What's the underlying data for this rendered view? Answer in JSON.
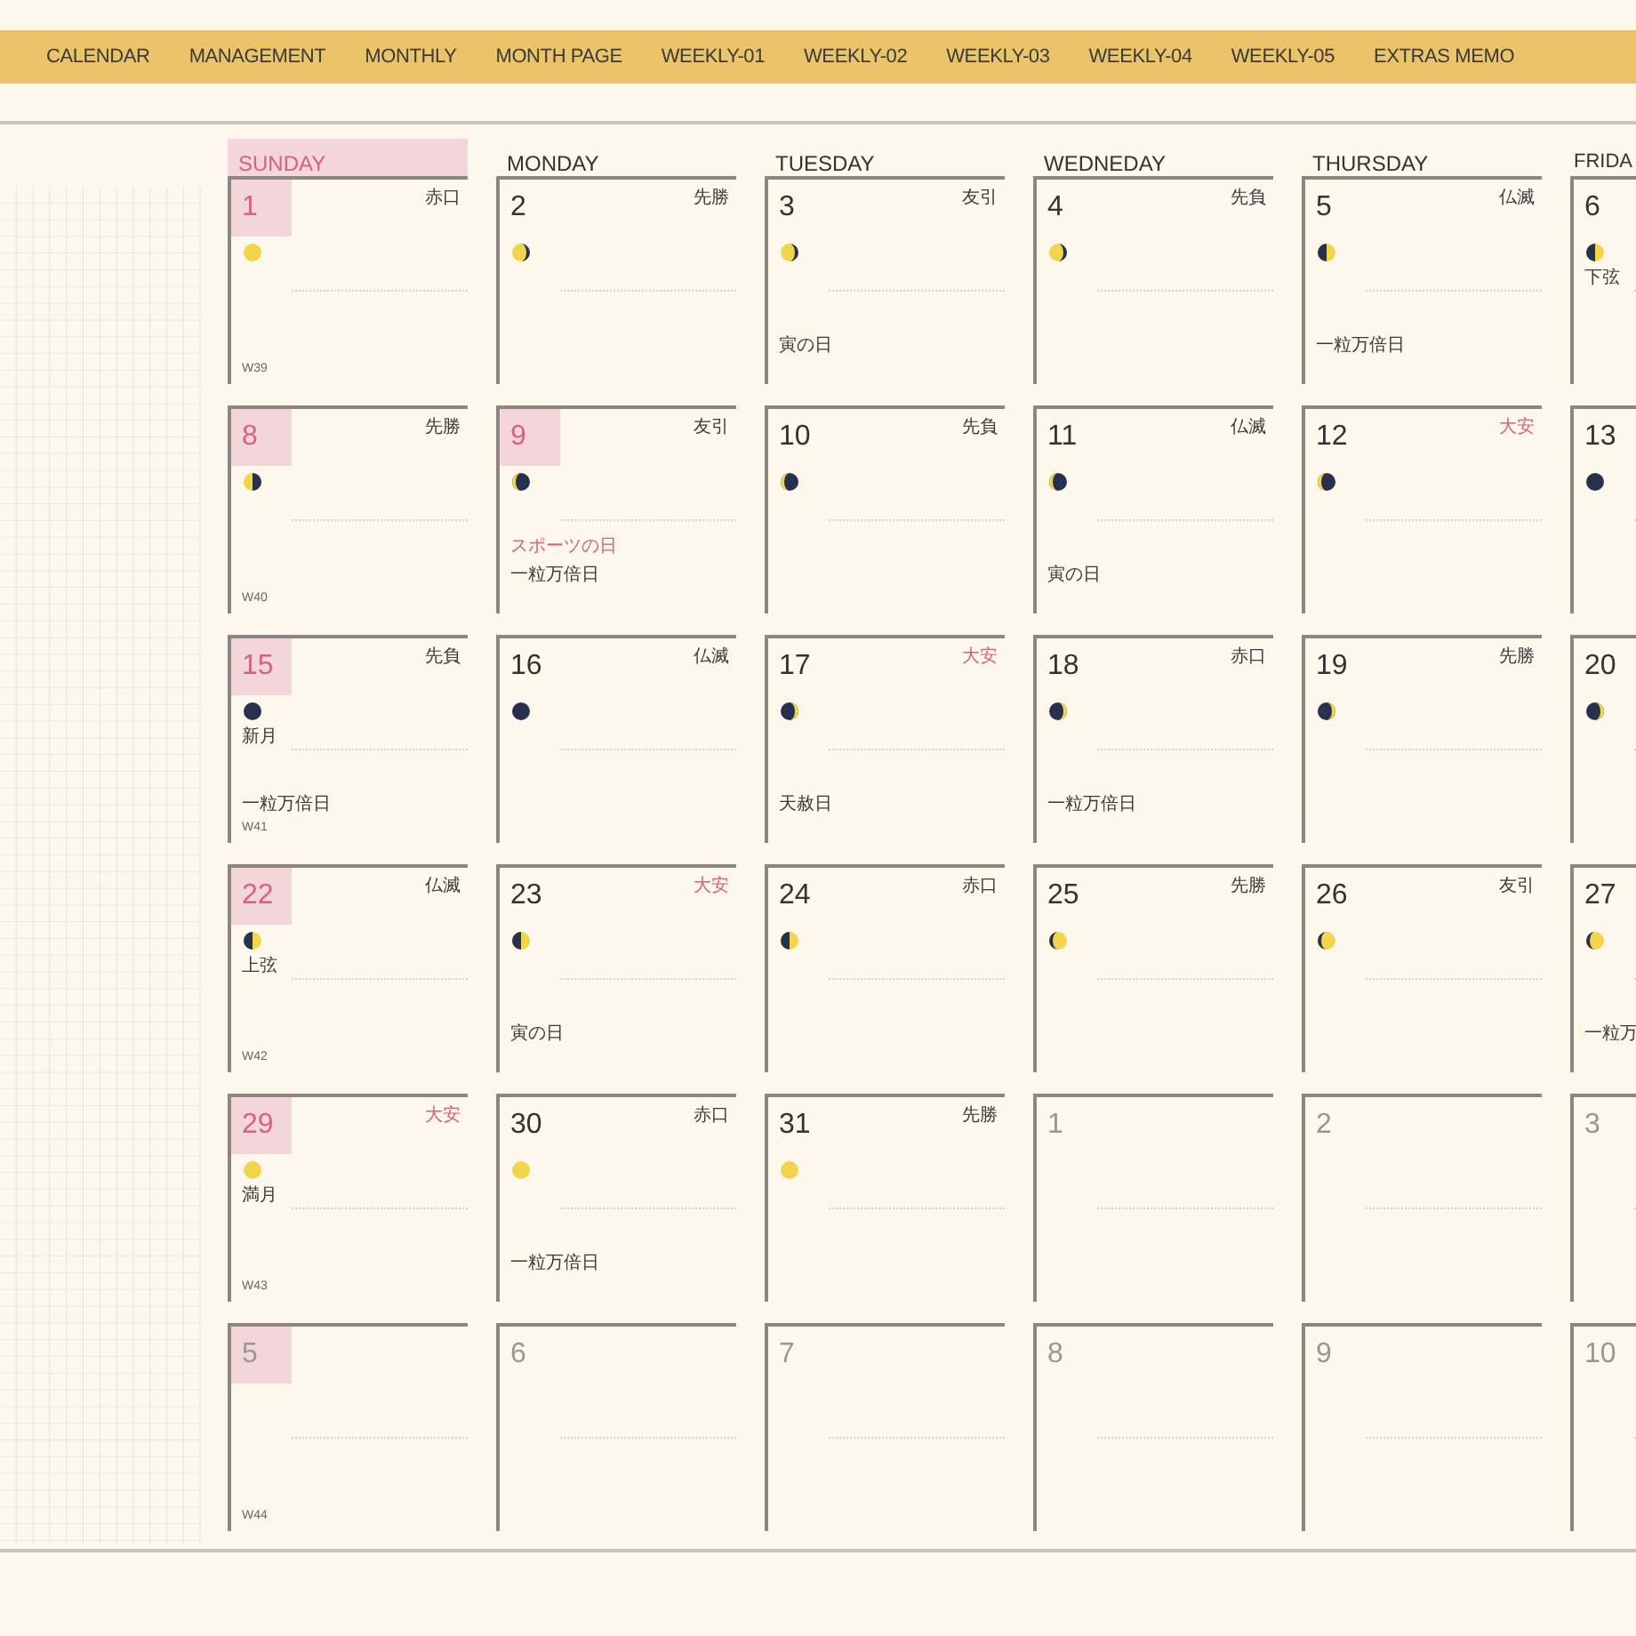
{
  "nav": [
    {
      "label": "CALENDAR"
    },
    {
      "label": "MANAGEMENT"
    },
    {
      "label": "MONTHLY"
    },
    {
      "label": "MONTH PAGE"
    },
    {
      "label": "WEEKLY-01"
    },
    {
      "label": "WEEKLY-02"
    },
    {
      "label": "WEEKLY-03"
    },
    {
      "label": "WEEKLY-04"
    },
    {
      "label": "WEEKLY-05"
    },
    {
      "label": "EXTRAS MEMO"
    }
  ],
  "weekdays": [
    {
      "label": "SUNDAY",
      "highlighted": true
    },
    {
      "label": "MONDAY",
      "highlighted": false
    },
    {
      "label": "TUESDAY",
      "highlighted": false
    },
    {
      "label": "WEDNEDAY",
      "highlighted": false
    },
    {
      "label": "THURSDAY",
      "highlighted": false
    },
    {
      "label": "FRIDA",
      "highlighted": false
    }
  ],
  "weeks": [
    [
      {
        "date": "1",
        "highlighted": true,
        "other_month": false,
        "rokuyo": {
          "text": "赤口",
          "color": "#3a3a3a"
        },
        "moon": {
          "kind": "full"
        },
        "week": "W39"
      },
      {
        "date": "2",
        "highlighted": false,
        "other_month": false,
        "rokuyo": {
          "text": "先勝",
          "color": "#3a3a3a"
        },
        "moon": {
          "kind": "gibbous-dark-right"
        }
      },
      {
        "date": "3",
        "highlighted": false,
        "other_month": false,
        "rokuyo": {
          "text": "友引",
          "color": "#3a3a3a"
        },
        "moon": {
          "kind": "gibbous-dark-right"
        },
        "events": [
          {
            "text": "寅の日",
            "color": "#3a3a3a"
          }
        ]
      },
      {
        "date": "4",
        "highlighted": false,
        "other_month": false,
        "rokuyo": {
          "text": "先負",
          "color": "#3a3a3a"
        },
        "moon": {
          "kind": "gibbous-dark-right"
        }
      },
      {
        "date": "5",
        "highlighted": false,
        "other_month": false,
        "rokuyo": {
          "text": "仏滅",
          "color": "#3a3a3a"
        },
        "moon": {
          "kind": "half-dark-left"
        },
        "events": [
          {
            "text": "一粒万倍日",
            "color": "#3a3a3a"
          }
        ]
      },
      {
        "date": "6",
        "highlighted": false,
        "other_month": false,
        "moon": {
          "kind": "half-dark-left"
        },
        "moon_label": "下弦"
      }
    ],
    [
      {
        "date": "8",
        "highlighted": true,
        "other_month": false,
        "rokuyo": {
          "text": "先勝",
          "color": "#3a3a3a"
        },
        "moon": {
          "kind": "half-dark-right"
        },
        "week": "W40"
      },
      {
        "date": "9",
        "highlighted": true,
        "other_month": false,
        "rokuyo": {
          "text": "友引",
          "color": "#3a3a3a"
        },
        "moon": {
          "kind": "crescent-lit-left"
        },
        "events": [
          {
            "text": "スポーツの日",
            "color": "#d9607f"
          },
          {
            "text": "一粒万倍日",
            "color": "#3a3a3a"
          }
        ]
      },
      {
        "date": "10",
        "highlighted": false,
        "other_month": false,
        "rokuyo": {
          "text": "先負",
          "color": "#3a3a3a"
        },
        "moon": {
          "kind": "crescent-lit-left"
        }
      },
      {
        "date": "11",
        "highlighted": false,
        "other_month": false,
        "rokuyo": {
          "text": "仏滅",
          "color": "#3a3a3a"
        },
        "moon": {
          "kind": "crescent-lit-left"
        },
        "events": [
          {
            "text": "寅の日",
            "color": "#3a3a3a"
          }
        ]
      },
      {
        "date": "12",
        "highlighted": false,
        "other_month": false,
        "rokuyo": {
          "text": "大安",
          "color": "#d9607f"
        },
        "moon": {
          "kind": "crescent-lit-left"
        }
      },
      {
        "date": "13",
        "highlighted": false,
        "other_month": false,
        "moon": {
          "kind": "new"
        }
      }
    ],
    [
      {
        "date": "15",
        "highlighted": true,
        "other_month": false,
        "rokuyo": {
          "text": "先負",
          "color": "#3a3a3a"
        },
        "moon": {
          "kind": "new"
        },
        "moon_label": "新月",
        "events": [
          {
            "text": "一粒万倍日",
            "color": "#3a3a3a"
          }
        ],
        "week": "W41"
      },
      {
        "date": "16",
        "highlighted": false,
        "other_month": false,
        "rokuyo": {
          "text": "仏滅",
          "color": "#3a3a3a"
        },
        "moon": {
          "kind": "new"
        }
      },
      {
        "date": "17",
        "highlighted": false,
        "other_month": false,
        "rokuyo": {
          "text": "大安",
          "color": "#d9607f"
        },
        "moon": {
          "kind": "crescent-lit-right"
        },
        "events": [
          {
            "text": "天赦日",
            "color": "#3a3a3a"
          }
        ]
      },
      {
        "date": "18",
        "highlighted": false,
        "other_month": false,
        "rokuyo": {
          "text": "赤口",
          "color": "#3a3a3a"
        },
        "moon": {
          "kind": "crescent-lit-right"
        },
        "events": [
          {
            "text": "一粒万倍日",
            "color": "#3a3a3a"
          }
        ]
      },
      {
        "date": "19",
        "highlighted": false,
        "other_month": false,
        "rokuyo": {
          "text": "先勝",
          "color": "#3a3a3a"
        },
        "moon": {
          "kind": "crescent-lit-right"
        }
      },
      {
        "date": "20",
        "highlighted": false,
        "other_month": false,
        "moon": {
          "kind": "crescent-lit-right"
        }
      }
    ],
    [
      {
        "date": "22",
        "highlighted": true,
        "other_month": false,
        "rokuyo": {
          "text": "仏滅",
          "color": "#3a3a3a"
        },
        "moon": {
          "kind": "half-dark-left"
        },
        "moon_label": "上弦",
        "week": "W42"
      },
      {
        "date": "23",
        "highlighted": false,
        "other_month": false,
        "rokuyo": {
          "text": "大安",
          "color": "#d9607f"
        },
        "moon": {
          "kind": "half-dark-left"
        },
        "events": [
          {
            "text": "寅の日",
            "color": "#3a3a3a"
          }
        ]
      },
      {
        "date": "24",
        "highlighted": false,
        "other_month": false,
        "rokuyo": {
          "text": "赤口",
          "color": "#3a3a3a"
        },
        "moon": {
          "kind": "half-dark-left"
        }
      },
      {
        "date": "25",
        "highlighted": false,
        "other_month": false,
        "rokuyo": {
          "text": "先勝",
          "color": "#3a3a3a"
        },
        "moon": {
          "kind": "gibbous-dark-left"
        }
      },
      {
        "date": "26",
        "highlighted": false,
        "other_month": false,
        "rokuyo": {
          "text": "友引",
          "color": "#3a3a3a"
        },
        "moon": {
          "kind": "gibbous-dark-left"
        }
      },
      {
        "date": "27",
        "highlighted": false,
        "other_month": false,
        "moon": {
          "kind": "gibbous-dark-left"
        },
        "events": [
          {
            "text": "一粒万",
            "color": "#3a3a3a"
          }
        ]
      }
    ],
    [
      {
        "date": "29",
        "highlighted": true,
        "other_month": false,
        "rokuyo": {
          "text": "大安",
          "color": "#d9607f"
        },
        "moon": {
          "kind": "full"
        },
        "moon_label": "満月",
        "week": "W43"
      },
      {
        "date": "30",
        "highlighted": false,
        "other_month": false,
        "rokuyo": {
          "text": "赤口",
          "color": "#3a3a3a"
        },
        "moon": {
          "kind": "full"
        },
        "events": [
          {
            "text": "一粒万倍日",
            "color": "#3a3a3a"
          }
        ]
      },
      {
        "date": "31",
        "highlighted": false,
        "other_month": false,
        "rokuyo": {
          "text": "先勝",
          "color": "#3a3a3a"
        },
        "moon": {
          "kind": "full"
        }
      },
      {
        "date": "1",
        "highlighted": false,
        "other_month": true
      },
      {
        "date": "2",
        "highlighted": false,
        "other_month": true
      },
      {
        "date": "3",
        "highlighted": false,
        "other_month": true
      }
    ],
    [
      {
        "date": "5",
        "highlighted": true,
        "other_month": true,
        "week": "W44"
      },
      {
        "date": "6",
        "highlighted": false,
        "other_month": true
      },
      {
        "date": "7",
        "highlighted": false,
        "other_month": true
      },
      {
        "date": "8",
        "highlighted": false,
        "other_month": true
      },
      {
        "date": "9",
        "highlighted": false,
        "other_month": true
      },
      {
        "date": "10",
        "highlighted": false,
        "other_month": true
      }
    ]
  ]
}
